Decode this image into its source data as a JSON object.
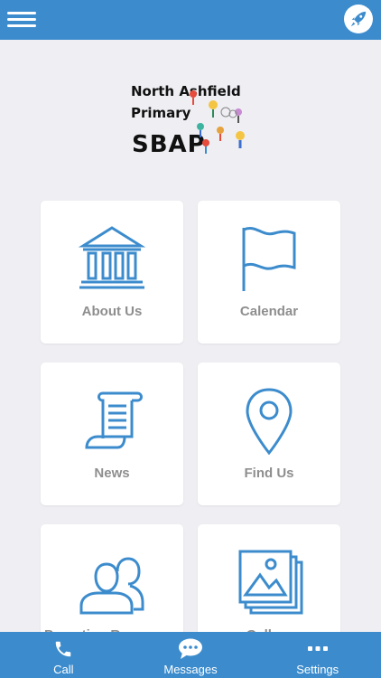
{
  "colors": {
    "brand": "#3c8ccd",
    "background": "#eeeef3",
    "tile": "#ffffff",
    "label": "#8e8e8e"
  },
  "header": {
    "menu_icon": "hamburger-icon",
    "action_icon": "rocket-icon"
  },
  "logo": {
    "line1": "North Ashfield",
    "line2": "Primary",
    "line3": "SBAP"
  },
  "tiles": [
    {
      "label": "About Us",
      "icon": "building-icon"
    },
    {
      "label": "Calendar",
      "icon": "flag-icon"
    },
    {
      "label": "News",
      "icon": "scroll-icon"
    },
    {
      "label": "Find Us",
      "icon": "map-pin-icon"
    },
    {
      "label": "Parenting Resources",
      "icon": "people-icon"
    },
    {
      "label": "Gallery",
      "icon": "gallery-icon"
    }
  ],
  "bottom_nav": [
    {
      "label": "Call",
      "icon": "phone-icon"
    },
    {
      "label": "Messages",
      "icon": "chat-bubble-icon"
    },
    {
      "label": "Settings",
      "icon": "more-dots-icon"
    }
  ]
}
